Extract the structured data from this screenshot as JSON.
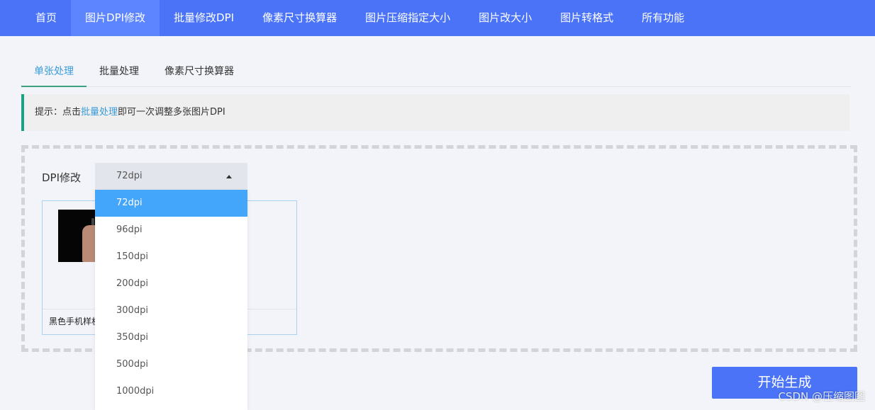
{
  "nav": {
    "items": [
      {
        "label": "首页"
      },
      {
        "label": "图片DPI修改",
        "active": true
      },
      {
        "label": "批量修改DPI"
      },
      {
        "label": "像素尺寸换算器"
      },
      {
        "label": "图片压缩指定大小"
      },
      {
        "label": "图片改大小"
      },
      {
        "label": "图片转格式"
      },
      {
        "label": "所有功能"
      }
    ]
  },
  "tabs": [
    {
      "label": "单张处理",
      "active": true
    },
    {
      "label": "批量处理"
    },
    {
      "label": "像素尺寸换算器"
    }
  ],
  "tip": {
    "prefix": "提示：点击",
    "link": "批量处理",
    "suffix": "即可一次调整多张图片DPI"
  },
  "dpi": {
    "label": "DPI修改",
    "selected": "72dpi",
    "options": [
      "72dpi",
      "96dpi",
      "150dpi",
      "200dpi",
      "300dpi",
      "350dpi",
      "500dpi",
      "1000dpi"
    ]
  },
  "file_card": {
    "filename": "黑色手机样机"
  },
  "actions": {
    "start_label": "开始生成"
  },
  "watermark": "CSDN @压缩图图",
  "colors": {
    "nav_bg": "#4a73f8",
    "accent_blue": "#3a9bd8",
    "tab_underline": "#3aa27f",
    "tip_border": "#1aa383",
    "option_selected": "#44a6fb"
  }
}
